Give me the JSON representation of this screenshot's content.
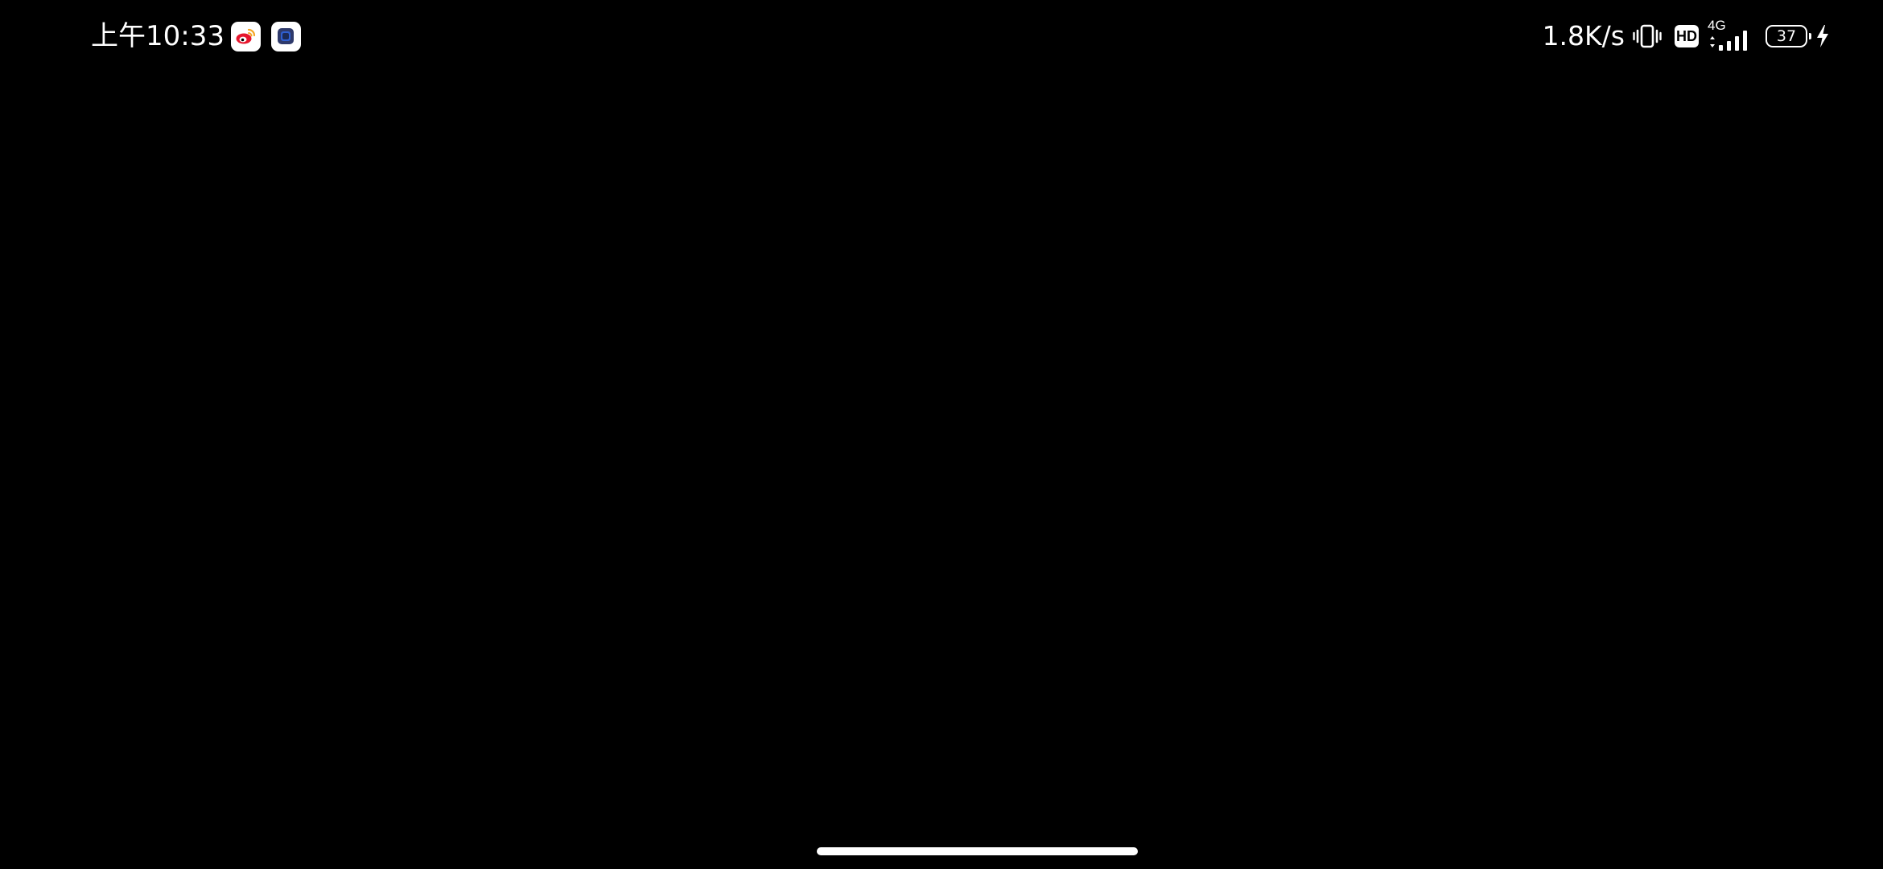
{
  "status_bar": {
    "time": "上午10:33",
    "notification_icons": [
      "weibo-icon",
      "app-icon"
    ],
    "network_speed": "1.8K/s",
    "hd_label": "HD",
    "network_type": "4G",
    "battery_level": "37",
    "charging": true
  },
  "colors": {
    "background": "#000000",
    "foreground": "#ffffff",
    "weibo_red": "#e6162d",
    "weibo_orange": "#f5a623",
    "app_icon_blue": "#2f5fd0"
  }
}
